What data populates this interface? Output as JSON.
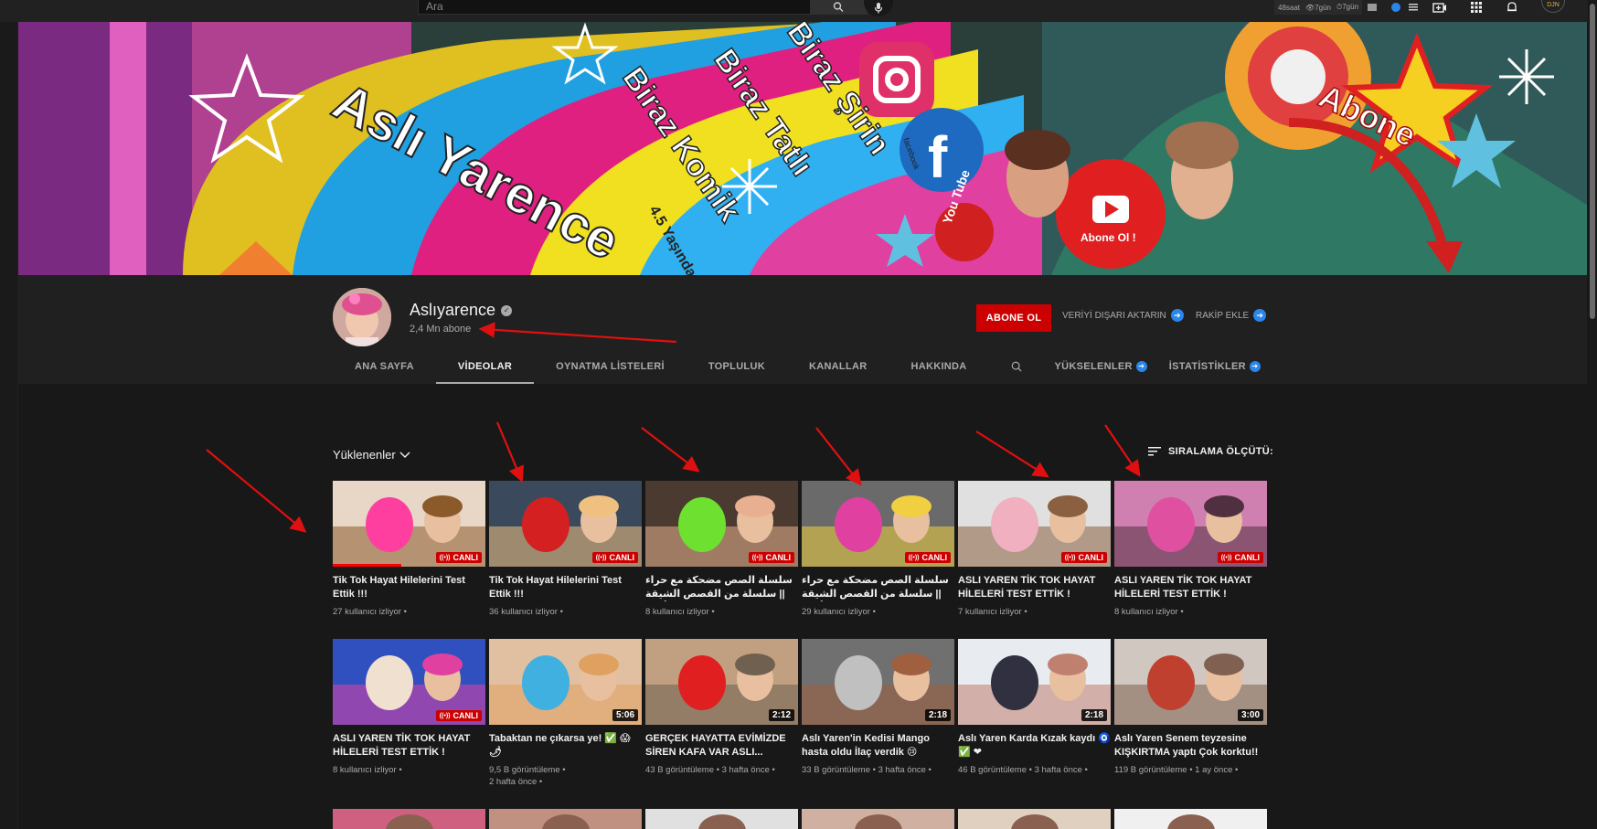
{
  "topbar": {
    "search_placeholder": "Ara",
    "search_icon": "search-icon",
    "mic_icon": "mic-icon",
    "ext_stats": [
      "48saat",
      "👁7gün",
      "⏱7gün"
    ],
    "avatar_text": "DJN"
  },
  "banner": {
    "title": "Aslı Yarence",
    "subtitle": "4.5 Yaşında",
    "rainbow_texts": [
      "Biraz Komik",
      "Biraz Tatlı",
      "Biraz Şirin"
    ],
    "subscribe_text": "Abone Ol !",
    "abone_text": "Abone",
    "facebook_text": "facebook",
    "youtube_text": "You Tube"
  },
  "channel": {
    "name": "Aslıyarence",
    "subscribers": "2,4 Mn abone",
    "subscribe_button": "ABONE OL",
    "export_button": "VERİYİ DIŞARI AKTARIN",
    "competitor_button": "RAKİP EKLE",
    "tabs": [
      {
        "label": "ANA SAYFA"
      },
      {
        "label": "VİDEOLAR"
      },
      {
        "label": "OYNATMA LİSTELERİ"
      },
      {
        "label": "TOPLULUK"
      },
      {
        "label": "KANALLAR"
      },
      {
        "label": "HAKKINDA"
      }
    ],
    "trending_tab": "YÜKSELENLER",
    "stats_tab": "İSTATİSTİKLER"
  },
  "content": {
    "filter_label": "Yüklenenler",
    "sort_label": "SIRALAMA ÖLÇÜTÜ:",
    "live_label": "CANLI",
    "videos": [
      {
        "title": "Tik Tok Hayat Hilelerini Test Ettik !!!",
        "meta": "27 kullanıcı izliyor •",
        "badge": "live",
        "colors": [
          "#e8d7c6",
          "#ff3fa0",
          "#8b5a2b"
        ]
      },
      {
        "title": "Tik Tok Hayat Hilelerini Test Ettik !!!",
        "meta": "36 kullanıcı izliyor •",
        "badge": "live",
        "colors": [
          "#3a4a5c",
          "#d42020",
          "#f0c080"
        ]
      },
      {
        "title": "سلسلة الصص مضحكة مع حراء || سلسلة من القصص الشيقة مع والدة هيرا وأبيها",
        "meta": "8 kullanıcı izliyor •",
        "badge": "live",
        "colors": [
          "#4a3a30",
          "#6ee030",
          "#e8b090"
        ]
      },
      {
        "title": "سلسلة الصص مضحكة مع حراء || سلسلة من القصص الشيقة مع والدة هيرا وأبيها",
        "meta": "29 kullanıcı izliyor •",
        "badge": "live",
        "colors": [
          "#6a6a6a",
          "#e040a0",
          "#f0d040"
        ]
      },
      {
        "title": "ASLI YAREN TİK TOK HAYAT HİLELERİ TEST ETTİK !",
        "meta": "7 kullanıcı izliyor •",
        "badge": "live",
        "colors": [
          "#e0e0e0",
          "#f0b0c0",
          "#8a6040"
        ]
      },
      {
        "title": "ASLI YAREN TİK TOK HAYAT HİLELERİ TEST ETTİK !",
        "meta": "8 kullanıcı izliyor •",
        "badge": "live",
        "colors": [
          "#d080b0",
          "#e050a0",
          "#503040"
        ]
      },
      {
        "title": "ASLI YAREN TİK TOK HAYAT HİLELERİ TEST ETTİK !",
        "meta": "8 kullanıcı izliyor •",
        "badge": "live",
        "colors": [
          "#3050c0",
          "#f0e0d0",
          "#e040a0"
        ]
      },
      {
        "title": "Tabaktan ne çıkarsa ye! ✅ 😱 🌶",
        "meta": "9,5 B görüntüleme •\n2 hafta önce •",
        "badge": "5:06",
        "colors": [
          "#e0c0a0",
          "#40b0e0",
          "#e0a060"
        ]
      },
      {
        "title": "GERÇEK HAYATTA EVİMİZDE SİREN KAFA VAR ASLI...",
        "meta": "43 B görüntüleme • 3 hafta önce •",
        "badge": "2:12",
        "colors": [
          "#c0a080",
          "#e02020",
          "#706050"
        ]
      },
      {
        "title": "Aslı Yaren'in Kedisi Mango hasta oldu İlaç verdik 😢",
        "meta": "33 B görüntüleme • 3 hafta önce •",
        "badge": "2:18",
        "colors": [
          "#707070",
          "#c0c0c0",
          "#a06040"
        ]
      },
      {
        "title": "Aslı Yaren Karda Kızak kaydı 🧿 ✅ ❤",
        "meta": "46 B görüntüleme • 3 hafta önce •",
        "badge": "2:18",
        "colors": [
          "#e8ecf0",
          "#303040",
          "#c08070"
        ]
      },
      {
        "title": "Aslı Yaren Senem teyzesine KIŞKIRTMA yaptı Çok korktu!!",
        "meta": "119 B görüntüleme • 1 ay önce •",
        "badge": "3:00",
        "colors": [
          "#d0c8c0",
          "#c04030",
          "#806050"
        ]
      }
    ],
    "row3_colors": [
      "#d06080",
      "#c09080",
      "#e0e0e0",
      "#d0b0a0",
      "#e0d0c0",
      "#f0f0f0"
    ]
  }
}
